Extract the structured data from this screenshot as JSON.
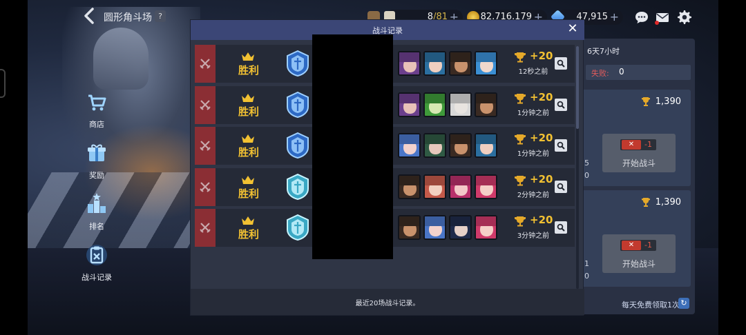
{
  "header": {
    "title": "圆形角斗场",
    "help": "?"
  },
  "resources": {
    "stamina_current": "8",
    "stamina_cap": "/81",
    "gold": "82,716,179",
    "gems": "47,915",
    "plus": "+"
  },
  "nav": [
    {
      "label": "商店",
      "icon": "cart-icon"
    },
    {
      "label": "奖励",
      "icon": "gift-icon"
    },
    {
      "label": "排名",
      "icon": "ranking-icon"
    },
    {
      "label": "战斗记录",
      "icon": "battle-log-icon"
    }
  ],
  "right_panel": {
    "timer": "6天7小时",
    "loss_label": "失败:",
    "loss_value": "0",
    "cards": [
      {
        "score": "1,390",
        "side_top": "5",
        "side_bottom": "0",
        "ticket": "✕",
        "cost": "-1",
        "button": "开始战斗"
      },
      {
        "score": "1,390",
        "side_top": "1",
        "side_bottom": "0",
        "ticket": "✕",
        "cost": "-1",
        "button": "开始战斗"
      }
    ],
    "free_text": "每天免费领取1次"
  },
  "modal": {
    "title": "战斗记录",
    "close": "✕",
    "footer": "最近20场战斗记录。",
    "records": [
      {
        "result": "胜利",
        "tier": "blue",
        "gain": "+20",
        "time": "12秒之前",
        "heroes": [
          [
            "#6b3f8c",
            "#e8c2b8"
          ],
          [
            "#2b6fa0",
            "#efcfc0"
          ],
          [
            "#3a2a22",
            "#c9926c"
          ],
          [
            "#3b8fd4",
            "#f1d8cc"
          ]
        ]
      },
      {
        "result": "胜利",
        "tier": "blue",
        "gain": "+20",
        "time": "1分钟之前",
        "heroes": [
          [
            "#6b3f8c",
            "#e8c2b8"
          ],
          [
            "#3f9a3a",
            "#d6e8b2"
          ],
          [
            "#d8d8d8",
            "#e8e4e0"
          ],
          [
            "#3a2a22",
            "#c9926c"
          ]
        ]
      },
      {
        "result": "胜利",
        "tier": "blue",
        "gain": "+20",
        "time": "1分钟之前",
        "heroes": [
          [
            "#4a76c8",
            "#f3d2cc"
          ],
          [
            "#2f5a44",
            "#e6c8bc"
          ],
          [
            "#3a2a22",
            "#c9926c"
          ],
          [
            "#2b6fa0",
            "#efcfc0"
          ]
        ]
      },
      {
        "result": "胜利",
        "tier": "cyan",
        "gain": "+20",
        "time": "2分钟之前",
        "heroes": [
          [
            "#3a2a22",
            "#c9926c"
          ],
          [
            "#c45a4a",
            "#f2d0c0"
          ],
          [
            "#b8306a",
            "#f3c8c8"
          ],
          [
            "#d03a6a",
            "#f6cfc8"
          ]
        ]
      },
      {
        "result": "胜利",
        "tier": "cyan",
        "gain": "+20",
        "time": "3分钟之前",
        "heroes": [
          [
            "#3a2a22",
            "#c9926c"
          ],
          [
            "#4a76c8",
            "#f3d2cc"
          ],
          [
            "#1f2a4a",
            "#e6d0c8"
          ],
          [
            "#d03a6a",
            "#f6cfc8"
          ]
        ]
      }
    ]
  },
  "colors": {
    "victory_gold": "#f2c132",
    "loss_red": "#e35b5b",
    "modal_header": "#3b4676",
    "record_stripe": "#8b2e34"
  }
}
